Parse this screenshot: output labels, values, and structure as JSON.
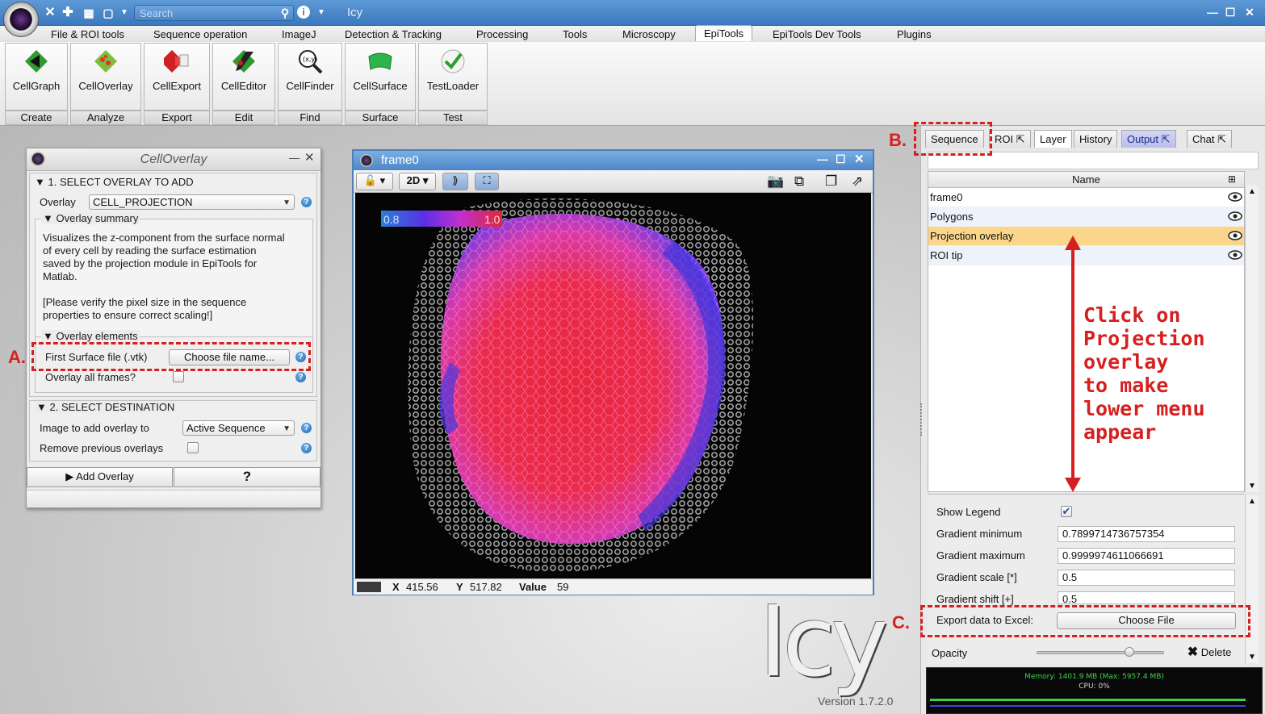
{
  "window": {
    "title": "Icy",
    "search_placeholder": "Search"
  },
  "menu": {
    "items": [
      "File & ROI tools",
      "Sequence operation",
      "ImageJ",
      "Detection & Tracking",
      "Processing",
      "Tools",
      "Microscopy",
      "EpiTools",
      "EpiTools Dev Tools",
      "Plugins"
    ],
    "active": "EpiTools"
  },
  "ribbon": {
    "buttons": [
      {
        "label": "CellGraph",
        "group": "Create"
      },
      {
        "label": "CellOverlay",
        "group": "Analyze"
      },
      {
        "label": "CellExport",
        "group": "Export"
      },
      {
        "label": "CellEditor",
        "group": "Edit"
      },
      {
        "label": "CellFinder",
        "group": "Find"
      },
      {
        "label": "CellSurface",
        "group": "Surface"
      },
      {
        "label": "TestLoader",
        "group": "Test"
      }
    ]
  },
  "cell_overlay": {
    "title": "CellOverlay",
    "section1": "1. SELECT OVERLAY TO ADD",
    "overlay_label": "Overlay",
    "overlay_value": "CELL_PROJECTION",
    "summary_title": "Overlay summary",
    "summary_text": "Visualizes the z-component from the surface normal of every cell by reading the surface estimation saved by the projection module in EpiTools for Matlab.",
    "summary_note": "[Please verify the pixel size in the sequence properties to ensure correct scaling!]",
    "elements_title": "Overlay elements",
    "surface_label": "First Surface file (.vtk)",
    "surface_button": "Choose file name...",
    "all_frames_label": "Overlay all frames?",
    "section2": "2. SELECT DESTINATION",
    "image_label": "Image to add overlay to",
    "image_value": "Active Sequence",
    "remove_label": "Remove previous overlays",
    "add_button": "Add Overlay",
    "help_button": "?"
  },
  "viewer": {
    "title": "frame0",
    "mode": "2D",
    "legend_min": "0.8",
    "legend_max": "1.0",
    "x_label": "X",
    "x_value": "415.56",
    "y_label": "Y",
    "y_value": "517.82",
    "value_label": "Value",
    "value_value": "59"
  },
  "right_panel": {
    "tabs": [
      "Sequence",
      "ROI",
      "Layer",
      "History",
      "Output",
      "Chat"
    ],
    "selected_tab": "Layer",
    "table_header": "Name",
    "layers": [
      "frame0",
      "Polygons",
      "Projection overlay",
      "ROI tip"
    ],
    "selected_layer": "Projection overlay",
    "props": {
      "show_legend": "Show Legend",
      "grad_min_label": "Gradient minimum",
      "grad_min": "0.7899714736757354",
      "grad_max_label": "Gradient maximum",
      "grad_max": "0.9999974611066691",
      "grad_scale_label": "Gradient scale [*]",
      "grad_scale": "0.5",
      "grad_shift_label": "Gradient shift [+]",
      "grad_shift": "0.5",
      "export_label": "Export data to Excel:",
      "export_button": "Choose File",
      "opacity_label": "Opacity",
      "delete_button": "Delete"
    },
    "memory": "Memory: 1401.9 MB (Max: 5957.4 MB)",
    "cpu": "CPU: 0%"
  },
  "annotations": {
    "a": "A.",
    "b": "B.",
    "c": "C.",
    "click_note": "Click on\nProjection\noverlay\nto make\nlower menu\nappear"
  },
  "branding": {
    "logo_text": "Icy",
    "version": "Version 1.7.2.0"
  },
  "colors": {
    "accent_red": "#d62020",
    "selected_row": "#fbd58a",
    "output_tab": "#b8bdea"
  }
}
